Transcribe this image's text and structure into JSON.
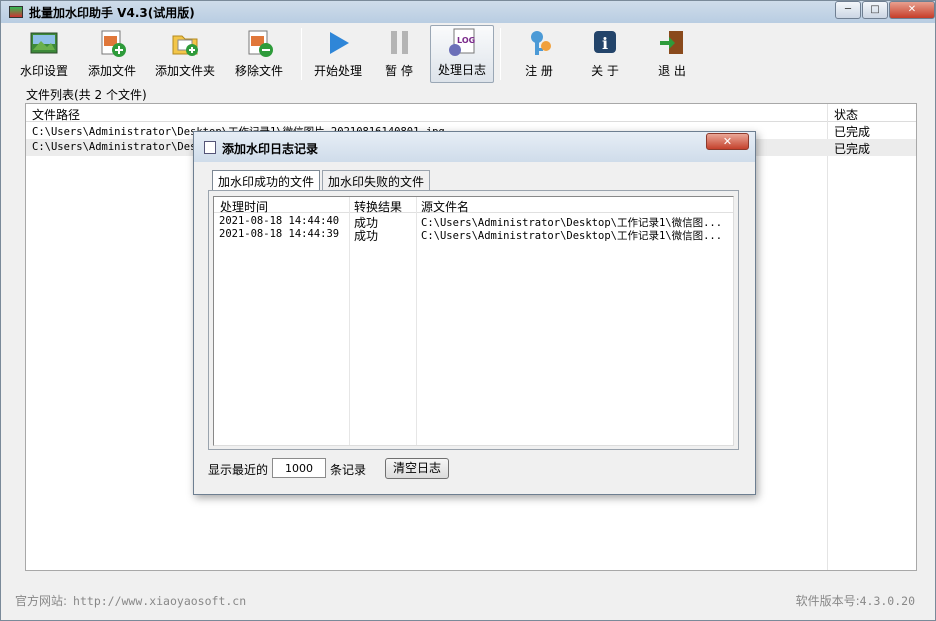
{
  "window": {
    "title": "批量加水印助手 V4.3(试用版)",
    "controls": {
      "minimize": "─",
      "maximize": "□",
      "close": "✕"
    }
  },
  "toolbar": {
    "items": [
      {
        "label": "水印设置",
        "icon": "watermark-settings-icon"
      },
      {
        "label": "添加文件",
        "icon": "add-file-icon"
      },
      {
        "label": "添加文件夹",
        "icon": "add-folder-icon"
      },
      {
        "label": "移除文件",
        "icon": "remove-file-icon"
      },
      {
        "label": "开始处理",
        "icon": "play-icon"
      },
      {
        "label": "暂 停",
        "icon": "pause-icon"
      },
      {
        "label": "处理日志",
        "icon": "log-icon"
      },
      {
        "label": "注 册",
        "icon": "key-icon"
      },
      {
        "label": "关 于",
        "icon": "info-icon"
      },
      {
        "label": "退 出",
        "icon": "exit-icon"
      }
    ]
  },
  "file_list": {
    "caption": "文件列表(共 2 个文件)",
    "columns": {
      "path": "文件路径",
      "status": "状态"
    },
    "rows": [
      {
        "path": "C:\\Users\\Administrator\\Desktop\\工作记录1\\微信图片_20210816140801.jpg",
        "status": "已完成"
      },
      {
        "path": "C:\\Users\\Administrator\\Desk",
        "status": "已完成"
      }
    ]
  },
  "footer": {
    "site_label": "官方网站:",
    "site_url": "http://www.xiaoyaosoft.cn",
    "version_label": "软件版本号:",
    "version": "4.3.0.20"
  },
  "dialog": {
    "title": "添加水印日志记录",
    "close_label": "✕",
    "tabs": [
      {
        "label": "加水印成功的文件",
        "active": true
      },
      {
        "label": "加水印失败的文件",
        "active": false
      }
    ],
    "columns": {
      "time": "处理时间",
      "result": "转换结果",
      "source": "源文件名"
    },
    "rows": [
      {
        "time": "2021-08-18 14:44:40",
        "result": "成功",
        "source": "C:\\Users\\Administrator\\Desktop\\工作记录1\\微信图..."
      },
      {
        "time": "2021-08-18 14:44:39",
        "result": "成功",
        "source": "C:\\Users\\Administrator\\Desktop\\工作记录1\\微信图..."
      }
    ],
    "show_recent_label": "显示最近的",
    "count_value": "1000",
    "records_label": "条记录",
    "clear_button": "清空日志"
  }
}
